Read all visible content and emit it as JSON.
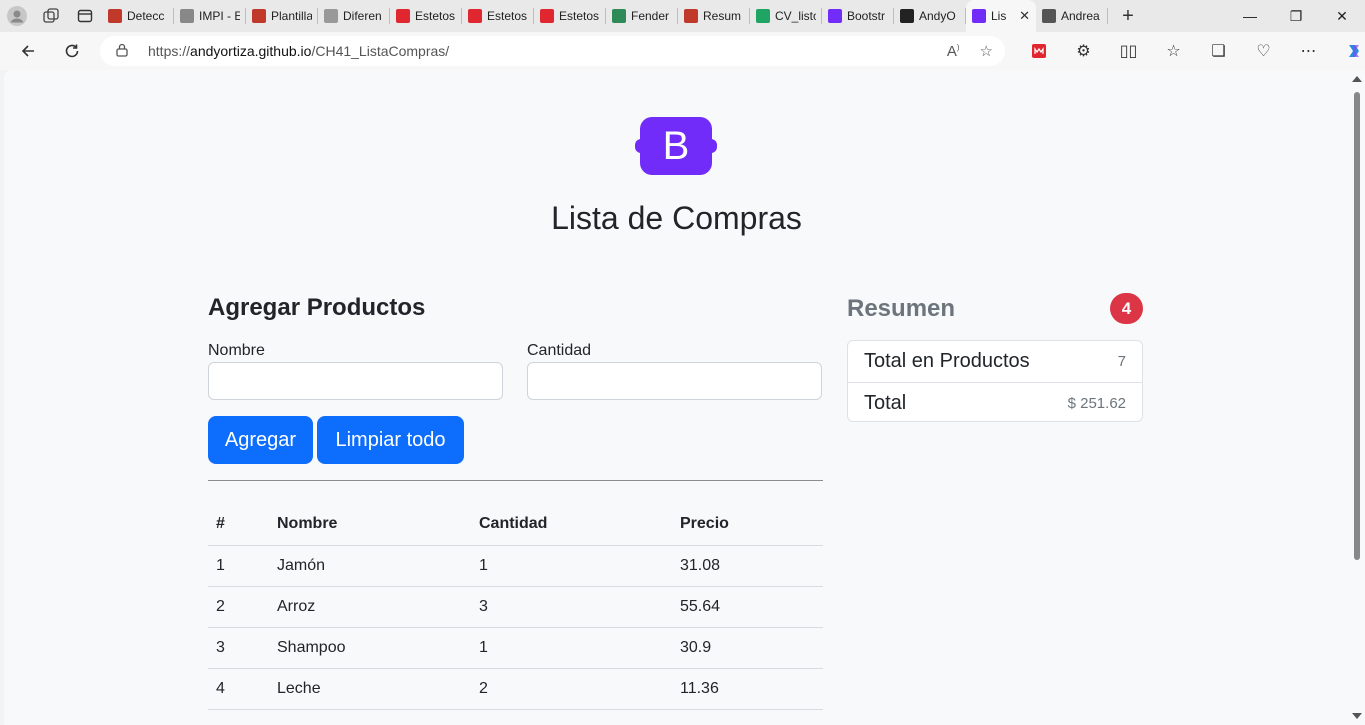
{
  "browser": {
    "tabs": [
      {
        "title": "Detecc",
        "icon": "pdf-icon",
        "color": "#c0392b"
      },
      {
        "title": "IMPI - E",
        "icon": "search-icon",
        "color": "#888888"
      },
      {
        "title": "Plantilla",
        "icon": "pdf-icon",
        "color": "#c0392b"
      },
      {
        "title": "Diferen",
        "icon": "image-icon",
        "color": "#999999"
      },
      {
        "title": "Estetos",
        "icon": "3m-icon",
        "color": "#e0262f"
      },
      {
        "title": "Estetos",
        "icon": "3m-icon",
        "color": "#e0262f"
      },
      {
        "title": "Estetos",
        "icon": "3m-icon",
        "color": "#e0262f"
      },
      {
        "title": "Fender",
        "icon": "leaf-icon",
        "color": "#2e8b57"
      },
      {
        "title": "Resum",
        "icon": "pdf-icon",
        "color": "#c0392b"
      },
      {
        "title": "CV_listo",
        "icon": "drive-icon",
        "color": "#1fa463"
      },
      {
        "title": "Bootstr",
        "icon": "bootstrap-icon",
        "color": "#712cf9"
      },
      {
        "title": "AndyO",
        "icon": "github-icon",
        "color": "#222222"
      },
      {
        "title": "Lis",
        "icon": "bootstrap-icon",
        "color": "#712cf9",
        "active": true
      },
      {
        "title": "Andrea",
        "icon": "document-icon",
        "color": "#555555"
      }
    ],
    "url_prefix": "https://",
    "url_host": "andyortiza.github.io",
    "url_path": "/CH41_ListaCompras/"
  },
  "page": {
    "logo_letter": "B",
    "title": "Lista de Compras",
    "form": {
      "heading": "Agregar Productos",
      "name_label": "Nombre",
      "name_value": "",
      "qty_label": "Cantidad",
      "qty_value": "",
      "add_button": "Agregar",
      "clear_button": "Limpiar todo"
    },
    "table": {
      "headers": [
        "#",
        "Nombre",
        "Cantidad",
        "Precio"
      ],
      "rows": [
        [
          "1",
          "Jamón",
          "1",
          "31.08"
        ],
        [
          "2",
          "Arroz",
          "3",
          "55.64"
        ],
        [
          "3",
          "Shampoo",
          "1",
          "30.9"
        ],
        [
          "4",
          "Leche",
          "2",
          "11.36"
        ]
      ]
    },
    "summary": {
      "heading": "Resumen",
      "badge": "4",
      "total_products_label": "Total en Productos",
      "total_products_value": "7",
      "total_label": "Total",
      "total_value": "$ 251.62"
    },
    "colors": {
      "primary": "#0d6efd",
      "badge": "#dc3545",
      "bootstrap_purple": "#712cf9"
    }
  }
}
